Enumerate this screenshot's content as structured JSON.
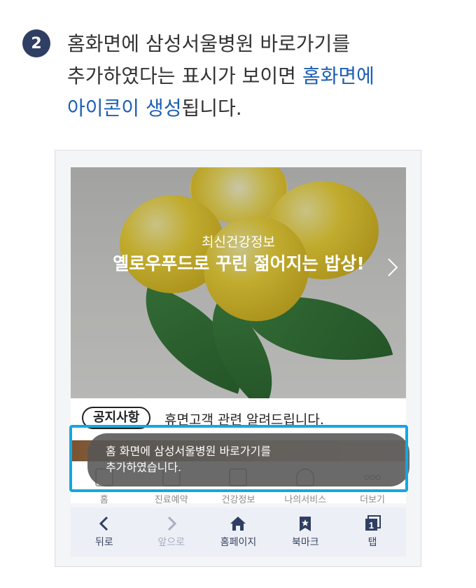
{
  "step": {
    "number": "2",
    "line1": "홈화면에 삼성서울병원 바로가기를",
    "line2_prefix": "추가하였다는 표시가 보이면 ",
    "line2_highlight": "홈화면에",
    "line3_highlight": "아이콘이 생성",
    "line3_suffix": "됩니다."
  },
  "banner": {
    "subtitle": "최신건강정보",
    "title": "옐로우푸드로 꾸린 젊어지는 밥상!",
    "next_icon": "chevron-right-icon"
  },
  "notice": {
    "badge": "공지사항",
    "text": "휴면고객 관련 알려드립니다."
  },
  "tabs": [
    {
      "label": "홈",
      "icon": "home-icon"
    },
    {
      "label": "진료예약",
      "icon": "calendar-icon"
    },
    {
      "label": "건강정보",
      "icon": "book-icon"
    },
    {
      "label": "나의서비스",
      "icon": "person-icon"
    },
    {
      "label": "더보기",
      "icon": "more-icon"
    }
  ],
  "toast": {
    "line1": "홈 화면에 삼성서울병원 바로가기를",
    "line2": "추가하였습니다."
  },
  "toolbar": {
    "back": "뒤로",
    "forward": "앞으로",
    "home": "홈페이지",
    "bookmark": "북마크",
    "tabs": "탭",
    "tab_count": "1"
  },
  "colors": {
    "badge": "#2f3f63",
    "highlight_text": "#1d5fb5",
    "highlight_box": "#13a7e2",
    "toolbar_bg": "#eceff5"
  }
}
